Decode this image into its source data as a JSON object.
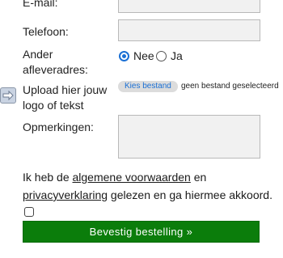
{
  "form": {
    "email_label": "E-mail:",
    "phone_label": "Telefoon:",
    "alt_address_label_line1": "Ander",
    "alt_address_label_line2": "afleveradres:",
    "alt_address_options": [
      {
        "label": "Nee",
        "checked": true
      },
      {
        "label": "Ja",
        "checked": false
      }
    ],
    "upload_label_line1": "Upload hier jouw",
    "upload_label_line2": "logo of tekst",
    "upload_button_label": "Kies bestand",
    "upload_status": "geen bestand geselecteerd",
    "remarks_label": "Opmerkingen:",
    "agree_text_1": "Ik heb de ",
    "agree_link_terms": "algemene voorwaarden",
    "agree_text_2": " en",
    "agree_link_privacy": "privacyverklaring",
    "agree_text_3": " gelezen en ga hiermee akkoord.",
    "agree_checked": false,
    "submit_label": "Bevestig bestelling »"
  },
  "colors": {
    "accent_blue": "#1a6fd4",
    "submit_green": "#0b7d0b",
    "field_bg": "#f1f1f1"
  },
  "icons": {
    "upload_hint": "arrow-right-icon"
  }
}
